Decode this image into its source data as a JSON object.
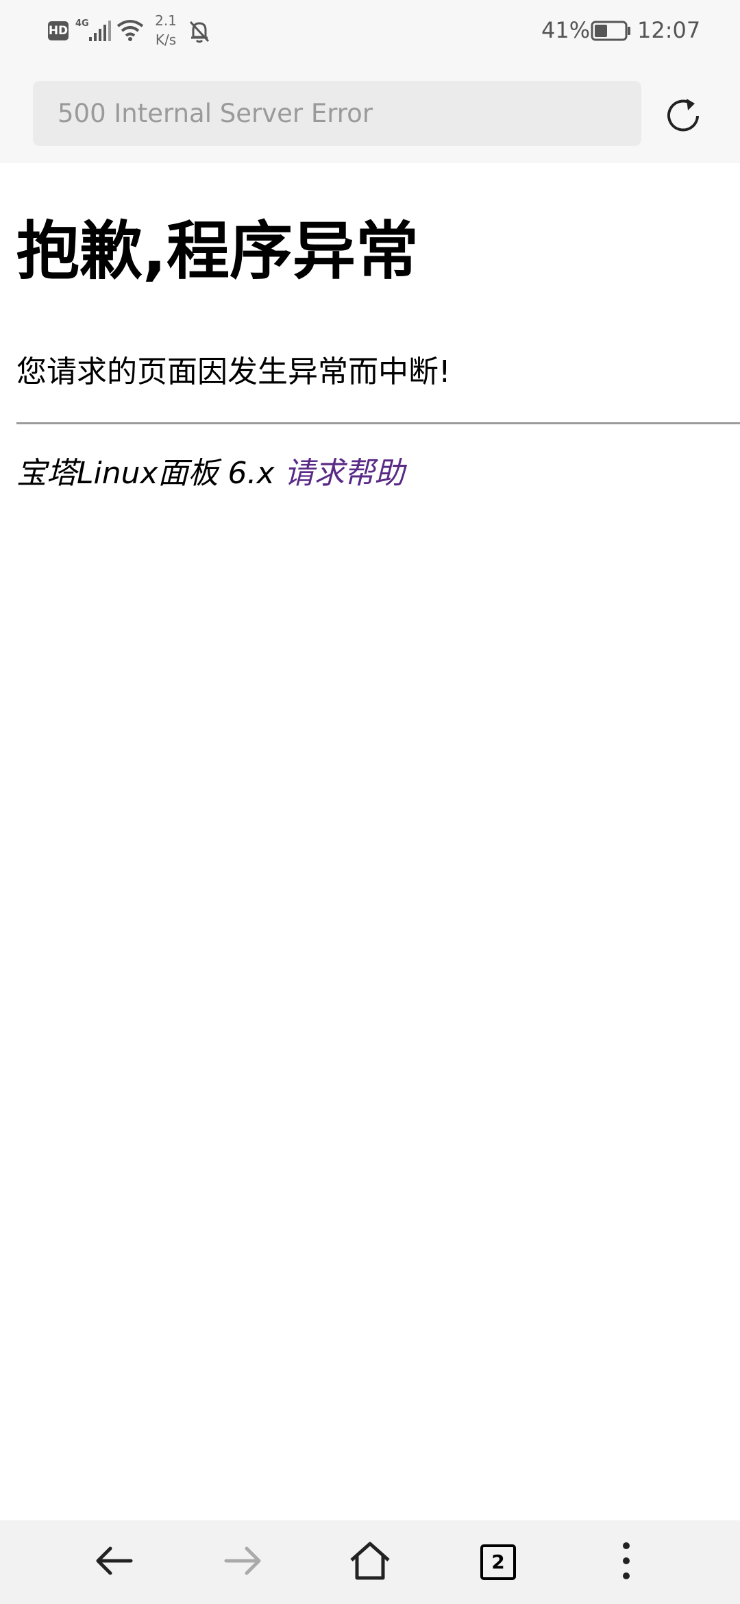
{
  "status_bar": {
    "hd_label": "HD",
    "network_type": "4G",
    "speed_value": "2.1",
    "speed_unit": "K/s",
    "battery_percent": "41%",
    "time": "12:07"
  },
  "address_bar": {
    "url_text": "500 Internal Server Error"
  },
  "page": {
    "title": "抱歉,程序异常",
    "message": "您请求的页面因发生异常而中断!",
    "footer_text": "宝塔Linux面板 6.x",
    "help_link": "请求帮助"
  },
  "bottom_nav": {
    "tab_count": "2"
  },
  "colors": {
    "link": "#5a2a86",
    "bar_background": "#f7f7f7",
    "url_field_background": "#ebebeb",
    "disabled_icon": "#aaaaaa"
  },
  "icons": [
    "signal-icon",
    "wifi-icon",
    "bell-off-icon",
    "battery-icon",
    "reload-icon",
    "back-arrow-icon",
    "forward-arrow-icon",
    "home-icon",
    "tabs-icon",
    "more-vertical-icon"
  ]
}
